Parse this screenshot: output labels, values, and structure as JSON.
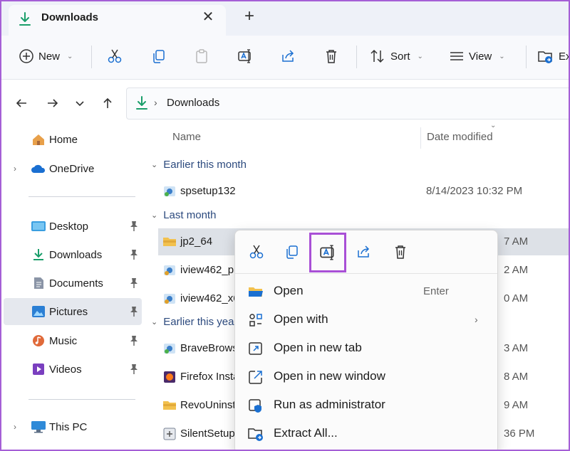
{
  "tab": {
    "title": "Downloads",
    "close": "✕",
    "new_tab": "+"
  },
  "toolbar": {
    "new_label": "New",
    "sort_label": "Sort",
    "view_label": "View",
    "extra_label": "Ex"
  },
  "address": {
    "path": "Downloads"
  },
  "sidebar": {
    "items": [
      {
        "label": "Home",
        "icon": "home-icon"
      },
      {
        "label": "OneDrive",
        "icon": "onedrive-icon"
      },
      {
        "label": "Desktop",
        "icon": "desktop-icon"
      },
      {
        "label": "Downloads",
        "icon": "download-icon"
      },
      {
        "label": "Documents",
        "icon": "documents-icon"
      },
      {
        "label": "Pictures",
        "icon": "pictures-icon"
      },
      {
        "label": "Music",
        "icon": "music-icon"
      },
      {
        "label": "Videos",
        "icon": "videos-icon"
      },
      {
        "label": "This PC",
        "icon": "pc-icon"
      }
    ]
  },
  "filelist": {
    "columns": {
      "name": "Name",
      "date": "Date modified"
    },
    "groups": [
      "Earlier this month",
      "Last month",
      "Earlier this year"
    ],
    "files": [
      {
        "name": "spsetup132",
        "date": "8/14/2023 10:32 PM"
      },
      {
        "name": "jp2_64",
        "date": "7 AM"
      },
      {
        "name": "iview462_pl",
        "date": "2 AM"
      },
      {
        "name": "iview462_x6",
        "date": "0 AM"
      },
      {
        "name": "BraveBrows",
        "date": "3 AM"
      },
      {
        "name": "Firefox Insta",
        "date": "8 AM"
      },
      {
        "name": "RevoUninst",
        "date": "9 AM"
      },
      {
        "name": "SilentSetup",
        "date": "36 PM"
      }
    ]
  },
  "context_menu": {
    "items": [
      {
        "label": "Open",
        "shortcut": "Enter"
      },
      {
        "label": "Open with",
        "arrow": "›"
      },
      {
        "label": "Open in new tab"
      },
      {
        "label": "Open in new window"
      },
      {
        "label": "Run as administrator"
      },
      {
        "label": "Extract All..."
      }
    ]
  }
}
